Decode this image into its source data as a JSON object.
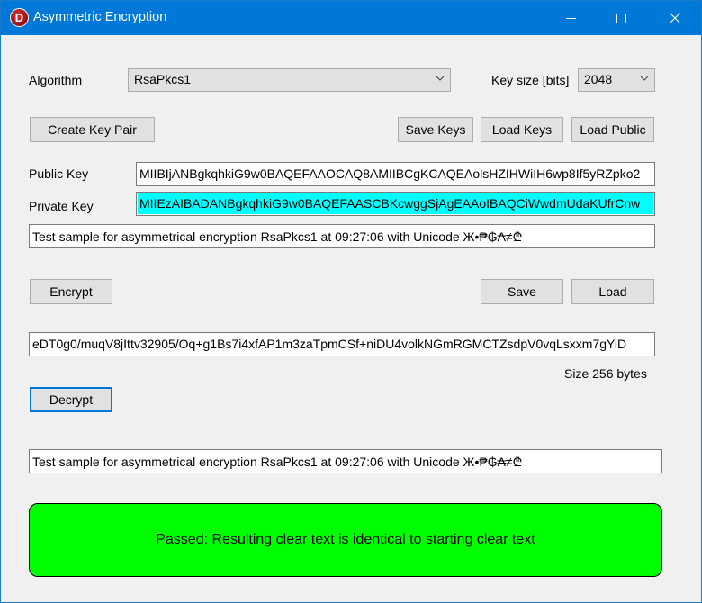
{
  "window": {
    "title": "Asymmetric Encryption",
    "icon_letter": "D"
  },
  "algorithm": {
    "label": "Algorithm",
    "selected": "RsaPkcs1"
  },
  "key_size": {
    "label": "Key size [bits]",
    "selected": "2048"
  },
  "key_buttons": {
    "create": "Create Key Pair",
    "save": "Save Keys",
    "load": "Load Keys",
    "load_public": "Load Public"
  },
  "public_key": {
    "label": "Public Key",
    "value": "MIIBIjANBgkqhkiG9w0BAQEFAAOCAQ8AMIIBCgKCAQEAolsHZIHWiIH6wp8If5yRZpko2"
  },
  "private_key": {
    "label": "Private Key",
    "value": "MIIEzAIBADANBgkqhkiG9w0BAQEFAASCBKcwggSjAgEAAoIBAQCiWwdmUdaKUfrCnw"
  },
  "clear_text": {
    "value": "Test sample for asymmetrical encryption RsaPkcs1 at 09:27:06 with Unicode Ж•₱₲₳≠₾"
  },
  "encrypt_buttons": {
    "encrypt": "Encrypt",
    "save": "Save",
    "load": "Load"
  },
  "cipher_text": {
    "value": "eDT0g0/muqV8jIttv32905/Oq+g1Bs7i4xfAP1m3zaTpmCSf+niDU4volkNGmRGMCTZsdpV0vqLsxxm7gYiD"
  },
  "size_text": "Size 256 bytes",
  "decrypt_button": "Decrypt",
  "decrypted_text": {
    "value": "Test sample for asymmetrical encryption RsaPkcs1 at 09:27:06 with Unicode Ж•₱₲₳≠₾"
  },
  "result": {
    "message": "Passed: Resulting clear text is identical to starting clear text",
    "color": "#00ff00"
  },
  "colors": {
    "titlebar": "#0078d7",
    "selection": "#00ffff"
  }
}
